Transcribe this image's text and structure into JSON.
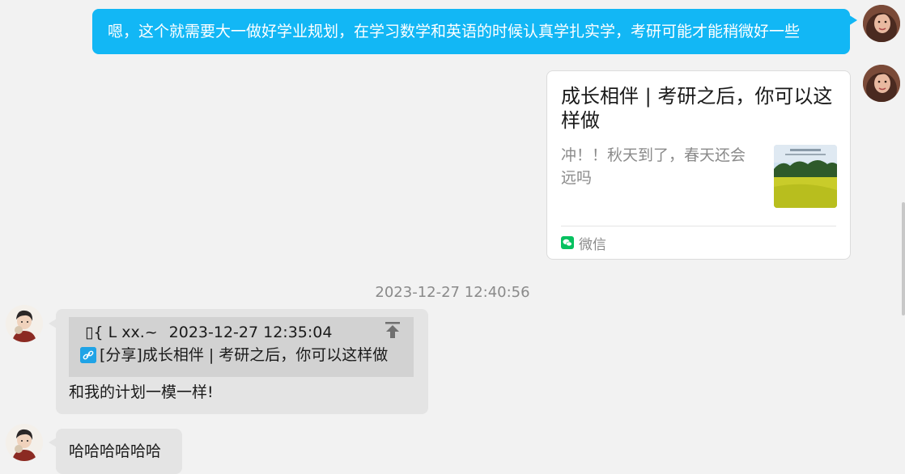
{
  "colors": {
    "outgoing_bubble": "#12b7f5",
    "incoming_bubble": "#e4e4e4",
    "quote_background": "#d2d2d2",
    "wechat_green": "#07c160"
  },
  "messages": {
    "outgoing_text": "嗯，这个就需要大一做好学业规划，在学习数学和英语的时候认真学扎实学，考研可能才能稍微好一些",
    "shared_card": {
      "title": "成长相伴 | 考研之后，你可以这样做",
      "description": "冲！！秋天到了，春天还会远吗",
      "source": "微信",
      "thumb_icon": "landscape-thumbnail"
    },
    "timestamp": "2023-12-27 12:40:56",
    "reply": {
      "quote_author": "▯{ L xx.~",
      "quote_time": "2023-12-27 12:35:04",
      "quote_text": "[分享]成长相伴 | 考研之后，你可以这样做",
      "text": "和我的计划一模一样!"
    },
    "last_text": "哈哈哈哈哈哈"
  },
  "icons": {
    "self_avatar": "female-avatar",
    "contact_avatar": "illustrated-avatar",
    "link": "link-icon",
    "jump": "jump-to-message-icon",
    "wechat": "wechat-icon"
  }
}
